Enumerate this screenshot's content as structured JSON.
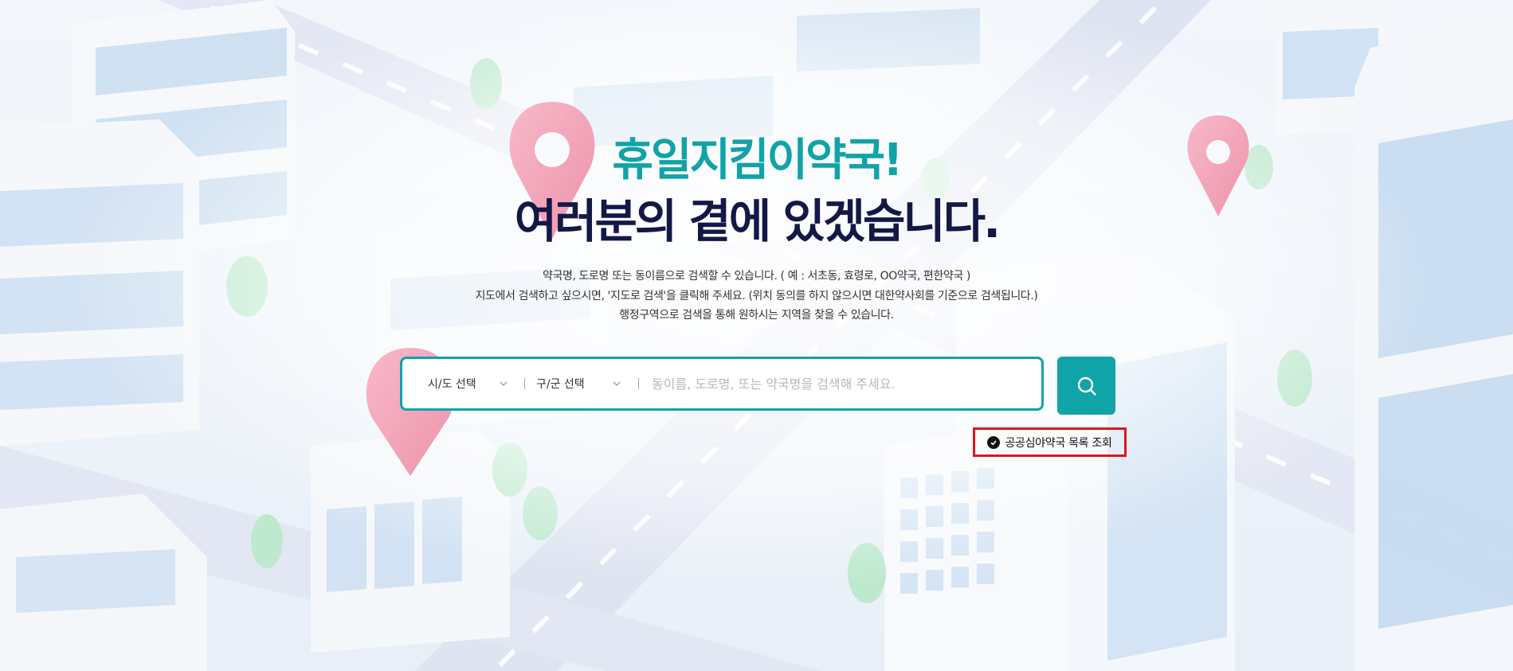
{
  "hero": {
    "title_line1": "휴일지킴이약국!",
    "title_line2": "여러분의 곁에 있겠습니다."
  },
  "description": {
    "line1": "약국명, 도로명 또는 동이름으로 검색할 수 있습니다. ( 예 : 서초동, 효령로, OO약국, 편한약국 )",
    "line2": "지도에서 검색하고 싶으시면, '지도로 검색'을 클릭해 주세요. (위치 동의를 하지 않으시면 대한약사회를 기준으로 검색됩니다.)",
    "line3": "행정구역으로 검색을 통해 원하시는 지역을 찾을 수 있습니다."
  },
  "search": {
    "sido_label": "시/도 선택",
    "gugun_label": "구/군 선택",
    "placeholder": "동이름, 도로명, 또는 약국명을 검색해 주세요.",
    "value": ""
  },
  "links": {
    "night_pharmacy": "공공심야약국 목록 조회"
  },
  "icons": {
    "search_button": "search-icon",
    "select_arrow": "chevron-down-icon",
    "night_link": "check-circle-icon"
  },
  "colors": {
    "accent": "#10a3a8",
    "title_dark": "#141846",
    "highlight_border": "#e3141b",
    "pin": "#f4a9bd"
  }
}
